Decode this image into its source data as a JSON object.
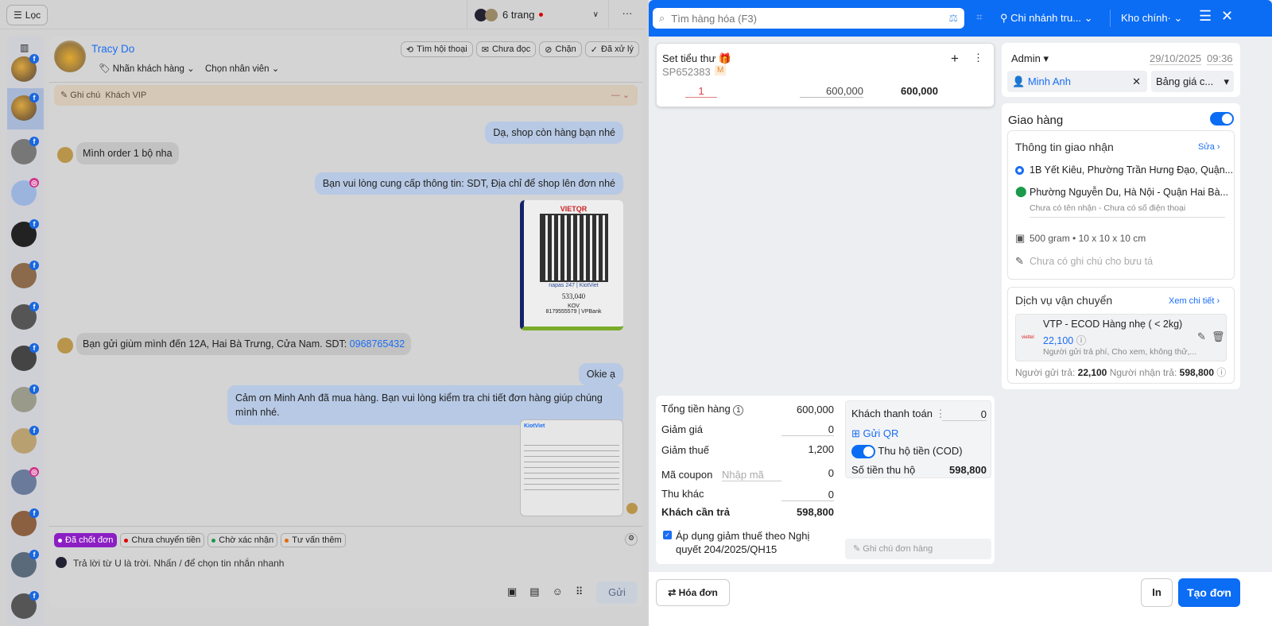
{
  "left": {
    "filter_label": "Lọc",
    "pages_label": "6 trang",
    "more": "···",
    "customer_name": "Tracy Do",
    "customer_tag": "Nhãn khách hàng",
    "assign_staff": "Chọn nhân viên",
    "actions": [
      "Tìm hội thoại",
      "Chưa đọc",
      "Chặn",
      "Đã xử lý"
    ],
    "note_label": "Ghi chú",
    "note_text": "Khách VIP",
    "messages": [
      {
        "side": "right",
        "text": "Dạ, shop còn hàng bạn nhé"
      },
      {
        "side": "left",
        "text": "Mình order 1 bộ nha"
      },
      {
        "side": "right",
        "text": "Bạn vui lòng cung cấp thông tin: SDT, Địa chỉ để shop lên đơn nhé"
      },
      {
        "side": "left",
        "text": "Bạn gửi giùm mình đến 12A, Hai Bà Trưng, Cửa Nam. SDT: ",
        "phone": "0968765432"
      },
      {
        "side": "right",
        "text": "Okie ạ"
      },
      {
        "side": "right",
        "text": "Cảm ơn Minh Anh đã mua hàng. Bạn vui lòng kiểm tra chi tiết đơn hàng giúp chúng mình nhé."
      }
    ],
    "qr": {
      "brand": "VIETQR",
      "partners": "napas 247 | KiotViet",
      "amount": "533,040",
      "account_name": "KOV",
      "account": "8179555579 | VPBank"
    },
    "invoice_brand": "KiotViet",
    "quick_tags": [
      {
        "label": "Đã chốt đơn",
        "color": "#8b1fc4"
      },
      {
        "label": "Chưa chuyển tiền",
        "color": "#d00"
      },
      {
        "label": "Chờ xác nhận",
        "color": "#1a9a4a"
      },
      {
        "label": "Tư vấn thêm",
        "color": "#e36a00"
      }
    ],
    "reply_placeholder": "Trả lời từ U là trời. Nhấn / để chọn tin nhắn nhanh",
    "send_label": "Gửi"
  },
  "right": {
    "search_placeholder": "Tìm hàng hóa (F3)",
    "branch": "Chi nhánh tru...",
    "warehouse": "Kho chính·",
    "product": {
      "name": "Set tiểu thư",
      "sku": "SP652383",
      "unit_badge": "M",
      "qty": "1",
      "price": "600,000",
      "total": "600,000"
    },
    "seller": "Admin",
    "date": "29/10/2025",
    "time": "09:36",
    "customer": "Minh Anh",
    "price_list": "Bảng giá c...",
    "delivery": {
      "title": "Giao hàng",
      "enabled": true,
      "info_title": "Thông tin giao nhận",
      "edit": "Sửa",
      "from": "1B Yết Kiêu, Phường Trần Hưng Đạo, Quận...",
      "to": "Phường Nguyễn Du, Hà Nội - Quận Hai Bà...",
      "receiver": "Chưa có tên nhận - Chưa có số điện thoại",
      "package": "500 gram • 10 x 10 x 10 cm",
      "courier_note": "Chưa có ghi chú cho bưu tá",
      "service_title": "Dịch vụ vận chuyển",
      "details": "Xem chi tiết",
      "service_name": "VTP - ECOD Hàng nhẹ ( < 2kg)",
      "service_fee": "22,100",
      "service_desc": "Người gửi trả phí, Cho xem, không thử,...",
      "carrier_logo": "viettel",
      "sender_pays_label": "Người gửi trả:",
      "sender_pays": "22,100",
      "receiver_pays_label": "Người nhận trả:",
      "receiver_pays": "598,800"
    },
    "summary": {
      "subtotal_label": "Tổng tiền hàng",
      "subtotal_count": "1",
      "subtotal": "600,000",
      "discount_label": "Giảm giá",
      "discount": "0",
      "tax_label": "Giảm thuế",
      "tax": "1,200",
      "coupon_label": "Mã coupon",
      "coupon_placeholder": "Nhập mã",
      "coupon": "0",
      "other_label": "Thu khác",
      "other": "0",
      "due_label": "Khách cần trả",
      "due": "598,800",
      "apply_tax": "Áp dụng giảm thuế theo Nghị quyết 204/2025/QH15"
    },
    "payment": {
      "paid_label": "Khách thanh toán",
      "paid": "0",
      "send_qr": "Gửi QR",
      "cod_label": "Thu hộ tiền (COD)",
      "cod_amount_label": "Số tiền thu hộ",
      "cod_amount": "598,800",
      "note_placeholder": "Ghi chú đơn hàng"
    },
    "footer": {
      "invoice": "Hóa đơn",
      "print": "In",
      "create": "Tạo đơn"
    }
  }
}
